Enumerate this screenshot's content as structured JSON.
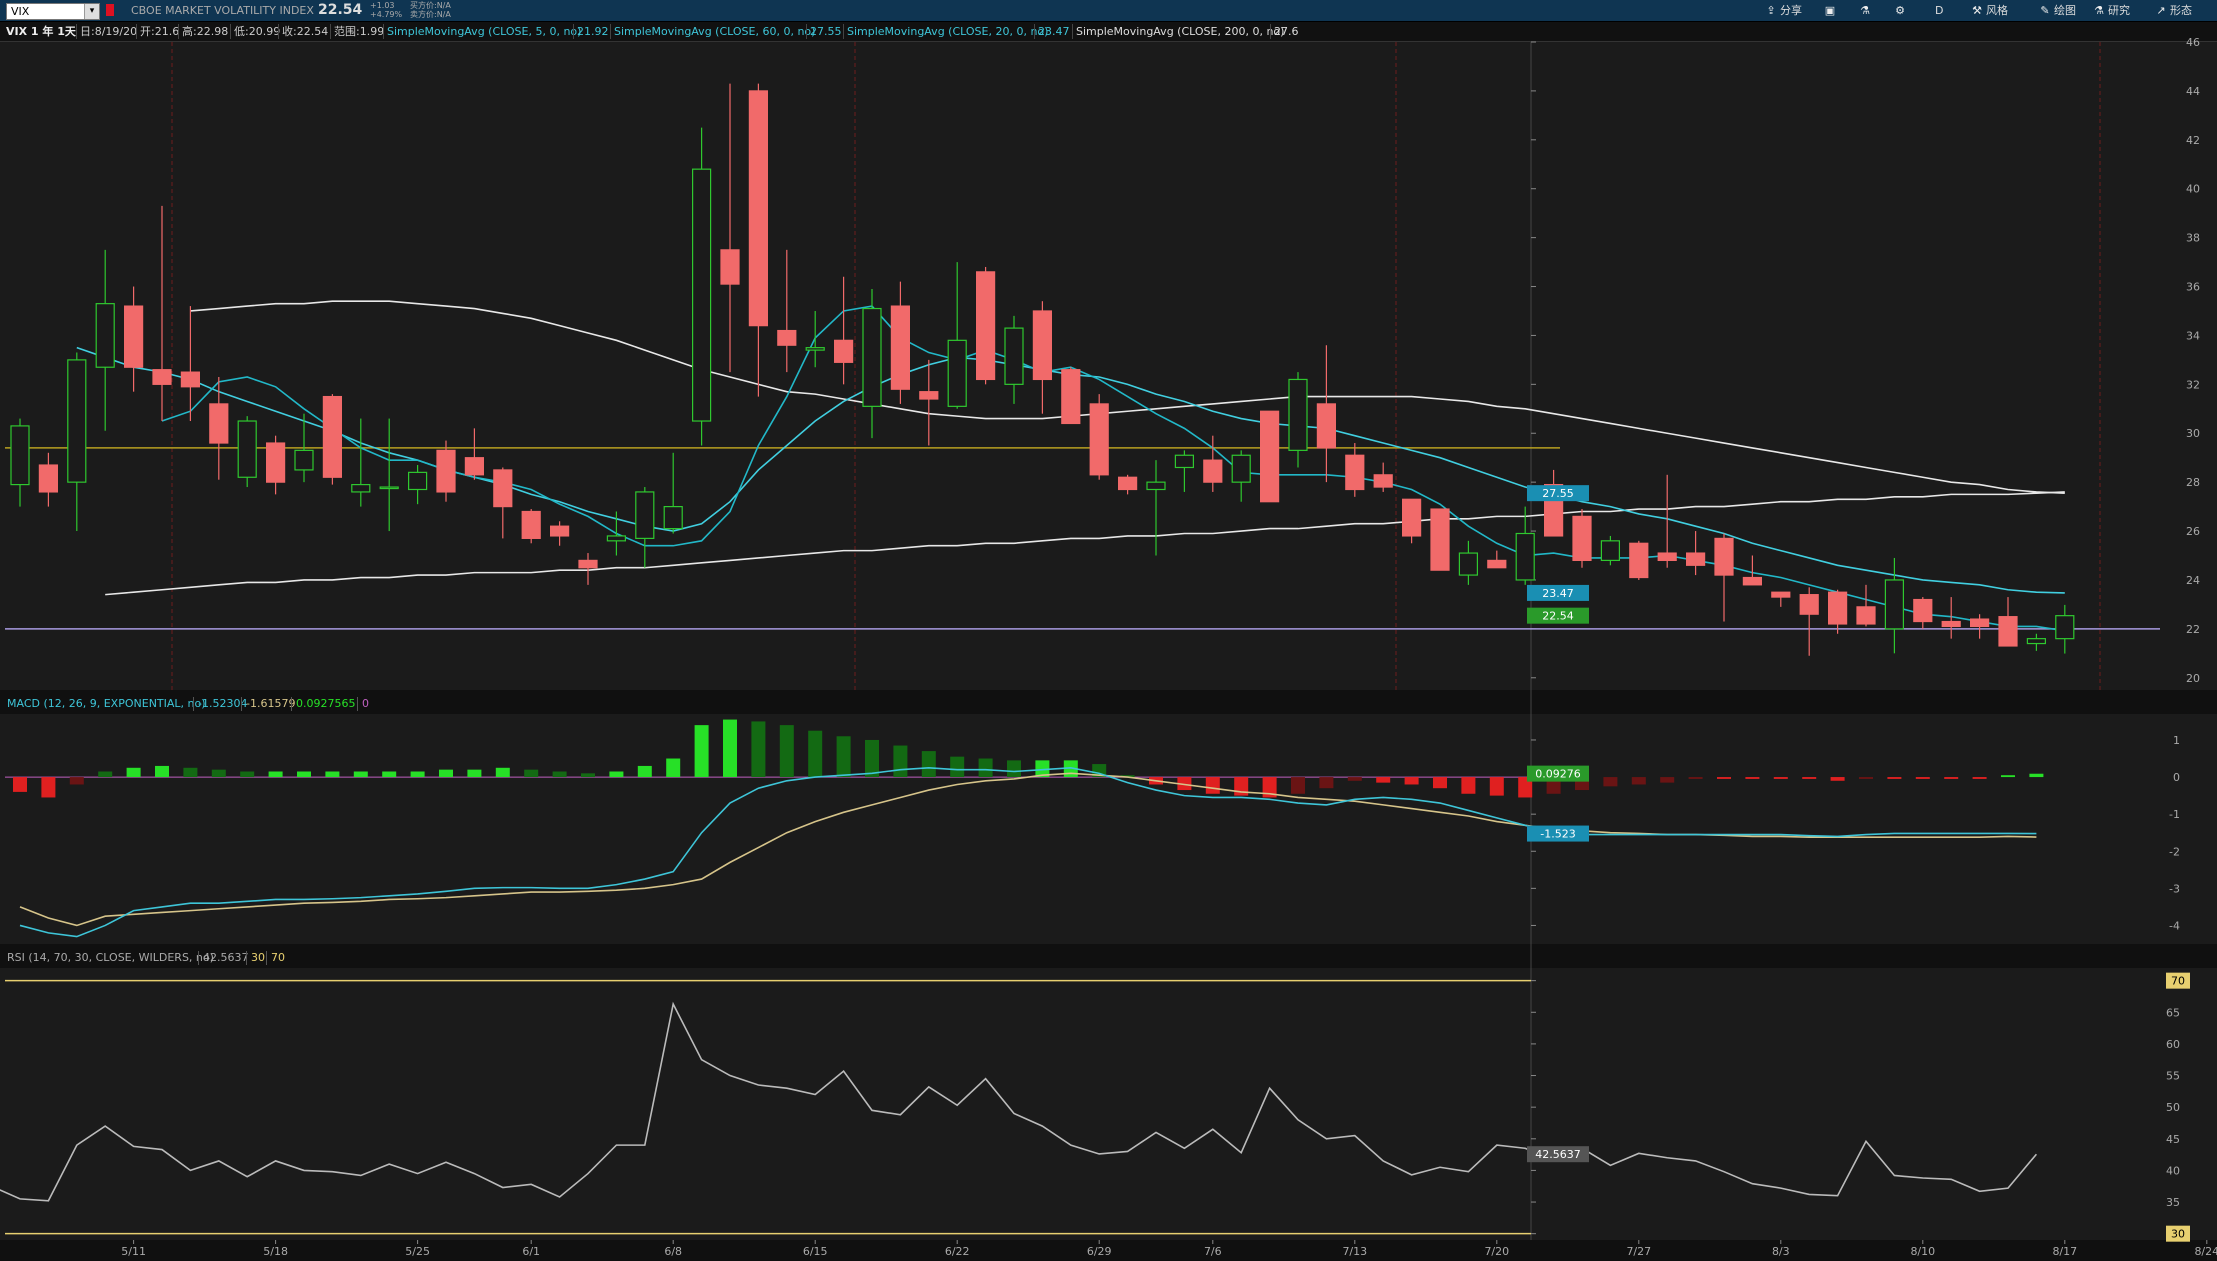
{
  "toolbar": {
    "symbol": "VIX",
    "company": "CBOE MARKET VOLATILITY INDEX",
    "last": "22.54",
    "change": "+1.03",
    "change_pct": "+4.79%",
    "bid": "买方价:N/A",
    "ask": "卖方价:N/A",
    "share": "分享",
    "style": "风格",
    "drawing": "绘图",
    "studies": "研究",
    "patterns": "形态",
    "aggregation": "D"
  },
  "infobar": {
    "period": "VIX 1 年 1天",
    "date": "日:8/19/20",
    "open": "开:21.6",
    "high": "高:22.98",
    "low": "低:20.99",
    "close": "收:22.54",
    "range": "范围:1.99",
    "sma5_label": "SimpleMovingAvg (CLOSE, 5, 0, no)",
    "sma5_val": "21.92",
    "sma60_label": "SimpleMovingAvg (CLOSE, 60, 0, no)",
    "sma60_val": "27.55",
    "sma20_label": "SimpleMovingAvg (CLOSE, 20, 0, no)",
    "sma20_val": "23.47",
    "sma200_label": "SimpleMovingAvg (CLOSE, 200, 0, no)",
    "sma200_val": "27.6"
  },
  "macd_header": {
    "label": "MACD (12, 26, 9, EXPONENTIAL, no)",
    "v1": "-1.52304",
    "v2": "-1.61579",
    "v3": "0.0927565",
    "v4": "0"
  },
  "rsi_header": {
    "label": "RSI (14, 70, 30, CLOSE, WILDERS, no)",
    "v1": "42.5637",
    "v2": "30",
    "v3": "70"
  },
  "colors": {
    "up": "#2fc82f",
    "down": "#f16a6a",
    "sma5": "#22b8c8",
    "sma20": "#41cfe0",
    "sma60": "#e8e8e8",
    "sma200": "#e8e8e8",
    "hline_yellow": "#b8a020",
    "hline_lav": "#a89be0",
    "grid_v": "#6e1c1c",
    "macd_line": "#3ec5d8",
    "signal_line": "#d6c48a",
    "hist_pos": "#27e027",
    "hist_pos_fade": "#136a13",
    "hist_neg": "#e02020",
    "hist_neg_fade": "#6a1414",
    "rsi_line": "#bbbbbb"
  },
  "chart_data": {
    "type": "candlestick",
    "title": "VIX 1 年 1天",
    "x_tick_labels": [
      "5/11",
      "5/18",
      "5/25",
      "6/1",
      "6/8",
      "6/15",
      "6/22",
      "6/29",
      "7/6",
      "7/13",
      "7/20",
      "7/27",
      "8/3",
      "8/10",
      "8/17",
      "8/24"
    ],
    "price_axis": {
      "ticks": [
        20,
        22,
        24,
        26,
        28,
        30,
        32,
        34,
        36,
        38,
        40,
        42,
        44,
        46
      ],
      "range": [
        19.5,
        46
      ]
    },
    "candles": [
      {
        "date": "5/5",
        "o": 27.9,
        "h": 30.6,
        "l": 27.0,
        "c": 30.3
      },
      {
        "date": "5/6",
        "o": 28.7,
        "h": 29.2,
        "l": 27.0,
        "c": 27.6
      },
      {
        "date": "5/7",
        "o": 28.0,
        "h": 33.3,
        "l": 26.0,
        "c": 33.0
      },
      {
        "date": "5/8",
        "o": 32.7,
        "h": 37.5,
        "l": 30.1,
        "c": 35.3
      },
      {
        "date": "5/11",
        "o": 35.2,
        "h": 36.0,
        "l": 31.7,
        "c": 32.7
      },
      {
        "date": "5/12",
        "o": 32.6,
        "h": 39.3,
        "l": 30.5,
        "c": 32.0
      },
      {
        "date": "5/13",
        "o": 32.5,
        "h": 35.2,
        "l": 30.5,
        "c": 31.9
      },
      {
        "date": "5/14",
        "o": 31.2,
        "h": 32.3,
        "l": 28.1,
        "c": 29.6
      },
      {
        "date": "5/15",
        "o": 28.2,
        "h": 30.7,
        "l": 27.8,
        "c": 30.5
      },
      {
        "date": "5/18",
        "o": 29.6,
        "h": 29.9,
        "l": 27.5,
        "c": 28.0
      },
      {
        "date": "5/19",
        "o": 28.5,
        "h": 30.8,
        "l": 28.0,
        "c": 29.3
      },
      {
        "date": "5/20",
        "o": 31.5,
        "h": 31.6,
        "l": 27.9,
        "c": 28.2
      },
      {
        "date": "5/21",
        "o": 27.6,
        "h": 30.6,
        "l": 27.0,
        "c": 27.9
      },
      {
        "date": "5/22",
        "o": 27.8,
        "h": 30.6,
        "l": 26.0,
        "c": 27.8
      },
      {
        "date": "5/26",
        "o": 27.7,
        "h": 28.7,
        "l": 27.1,
        "c": 28.4
      },
      {
        "date": "5/27",
        "o": 29.3,
        "h": 29.7,
        "l": 27.2,
        "c": 27.6
      },
      {
        "date": "5/28",
        "o": 29.0,
        "h": 30.2,
        "l": 28.1,
        "c": 28.3
      },
      {
        "date": "5/29",
        "o": 28.5,
        "h": 28.6,
        "l": 25.7,
        "c": 27.0
      },
      {
        "date": "6/1",
        "o": 26.8,
        "h": 26.9,
        "l": 25.5,
        "c": 25.7
      },
      {
        "date": "6/2",
        "o": 26.2,
        "h": 26.4,
        "l": 25.4,
        "c": 25.8
      },
      {
        "date": "6/3",
        "o": 24.8,
        "h": 25.1,
        "l": 23.8,
        "c": 24.5
      },
      {
        "date": "6/4",
        "o": 25.6,
        "h": 26.8,
        "l": 25.0,
        "c": 25.8
      },
      {
        "date": "6/5",
        "o": 25.7,
        "h": 27.8,
        "l": 24.5,
        "c": 27.6
      },
      {
        "date": "6/8",
        "o": 26.1,
        "h": 29.2,
        "l": 25.9,
        "c": 27.0
      },
      {
        "date": "6/9",
        "o": 30.5,
        "h": 42.5,
        "l": 29.5,
        "c": 40.8
      },
      {
        "date": "6/10",
        "o": 37.5,
        "h": 44.3,
        "l": 32.5,
        "c": 36.1
      },
      {
        "date": "6/11",
        "o": 44.0,
        "h": 44.3,
        "l": 31.5,
        "c": 34.4
      },
      {
        "date": "6/12",
        "o": 34.2,
        "h": 37.5,
        "l": 32.5,
        "c": 33.6
      },
      {
        "date": "6/15",
        "o": 33.4,
        "h": 35.0,
        "l": 32.7,
        "c": 33.5
      },
      {
        "date": "6/16",
        "o": 33.8,
        "h": 36.4,
        "l": 32.0,
        "c": 32.9
      },
      {
        "date": "6/17",
        "o": 31.1,
        "h": 35.9,
        "l": 29.8,
        "c": 35.1
      },
      {
        "date": "6/18",
        "o": 35.2,
        "h": 36.2,
        "l": 31.2,
        "c": 31.8
      },
      {
        "date": "6/19",
        "o": 31.7,
        "h": 33.0,
        "l": 29.5,
        "c": 31.4
      },
      {
        "date": "6/22",
        "o": 31.1,
        "h": 37.0,
        "l": 31.0,
        "c": 33.8
      },
      {
        "date": "6/23",
        "o": 36.6,
        "h": 36.8,
        "l": 32.0,
        "c": 32.2
      },
      {
        "date": "6/24",
        "o": 32.0,
        "h": 34.8,
        "l": 31.2,
        "c": 34.3
      },
      {
        "date": "6/25",
        "o": 35.0,
        "h": 35.4,
        "l": 30.8,
        "c": 32.2
      },
      {
        "date": "6/26",
        "o": 32.6,
        "h": 32.7,
        "l": 30.6,
        "c": 30.4
      },
      {
        "date": "6/29",
        "o": 31.2,
        "h": 31.6,
        "l": 28.1,
        "c": 28.3
      },
      {
        "date": "6/30",
        "o": 28.2,
        "h": 28.3,
        "l": 27.5,
        "c": 27.7
      },
      {
        "date": "7/1",
        "o": 27.7,
        "h": 28.9,
        "l": 25.0,
        "c": 28.0
      },
      {
        "date": "7/2",
        "o": 28.6,
        "h": 29.3,
        "l": 27.6,
        "c": 29.1
      },
      {
        "date": "7/6",
        "o": 28.9,
        "h": 29.9,
        "l": 27.6,
        "c": 28.0
      },
      {
        "date": "7/7",
        "o": 28.0,
        "h": 29.3,
        "l": 27.2,
        "c": 29.1
      },
      {
        "date": "7/8",
        "o": 30.9,
        "h": 30.9,
        "l": 28.5,
        "c": 27.2
      },
      {
        "date": "7/9",
        "o": 29.3,
        "h": 32.5,
        "l": 28.6,
        "c": 32.2
      },
      {
        "date": "7/10",
        "o": 31.2,
        "h": 33.6,
        "l": 28.0,
        "c": 29.4
      },
      {
        "date": "7/13",
        "o": 29.1,
        "h": 29.6,
        "l": 27.4,
        "c": 27.7
      },
      {
        "date": "7/14",
        "o": 28.3,
        "h": 28.8,
        "l": 27.6,
        "c": 27.8
      },
      {
        "date": "7/15",
        "o": 27.3,
        "h": 27.3,
        "l": 25.5,
        "c": 25.8
      },
      {
        "date": "7/16",
        "o": 26.9,
        "h": 26.9,
        "l": 24.4,
        "c": 24.4
      },
      {
        "date": "7/17",
        "o": 24.2,
        "h": 25.6,
        "l": 23.8,
        "c": 25.1
      },
      {
        "date": "7/20",
        "o": 24.8,
        "h": 25.2,
        "l": 24.5,
        "c": 24.5
      },
      {
        "date": "7/21",
        "o": 24.0,
        "h": 27.0,
        "l": 23.8,
        "c": 25.9
      },
      {
        "date": "7/22",
        "o": 27.9,
        "h": 28.5,
        "l": 25.8,
        "c": 25.8
      },
      {
        "date": "7/23",
        "o": 26.6,
        "h": 26.9,
        "l": 24.5,
        "c": 24.8
      },
      {
        "date": "7/24",
        "o": 24.8,
        "h": 25.8,
        "l": 24.6,
        "c": 25.6
      },
      {
        "date": "7/27",
        "o": 25.5,
        "h": 25.6,
        "l": 24.0,
        "c": 24.1
      },
      {
        "date": "7/28",
        "o": 25.1,
        "h": 28.3,
        "l": 24.5,
        "c": 24.8
      },
      {
        "date": "7/29",
        "o": 25.1,
        "h": 26.0,
        "l": 24.2,
        "c": 24.6
      },
      {
        "date": "7/30",
        "o": 25.7,
        "h": 25.9,
        "l": 22.3,
        "c": 24.2
      },
      {
        "date": "7/31",
        "o": 24.1,
        "h": 25.0,
        "l": 23.8,
        "c": 23.8
      },
      {
        "date": "8/3",
        "o": 23.5,
        "h": 23.5,
        "l": 22.9,
        "c": 23.3
      },
      {
        "date": "8/4",
        "o": 23.4,
        "h": 23.7,
        "l": 20.9,
        "c": 22.6
      },
      {
        "date": "8/5",
        "o": 23.5,
        "h": 23.6,
        "l": 21.8,
        "c": 22.2
      },
      {
        "date": "8/6",
        "o": 22.9,
        "h": 23.8,
        "l": 22.1,
        "c": 22.2
      },
      {
        "date": "8/7",
        "o": 22.0,
        "h": 24.9,
        "l": 21.0,
        "c": 24.0
      },
      {
        "date": "8/10",
        "o": 23.2,
        "h": 23.3,
        "l": 22.0,
        "c": 22.3
      },
      {
        "date": "8/11",
        "o": 22.3,
        "h": 23.3,
        "l": 21.6,
        "c": 22.1
      },
      {
        "date": "8/12",
        "o": 22.4,
        "h": 22.6,
        "l": 21.6,
        "c": 22.1
      },
      {
        "date": "8/13",
        "o": 22.5,
        "h": 23.3,
        "l": 21.9,
        "c": 21.3
      },
      {
        "date": "8/14",
        "o": 21.4,
        "h": 21.8,
        "l": 21.1,
        "c": 21.6
      },
      {
        "date": "8/17",
        "o": 21.6,
        "h": 22.98,
        "l": 20.99,
        "c": 22.54
      }
    ],
    "sma5_values": [
      null,
      null,
      null,
      null,
      30.5,
      30.9,
      32.1,
      32.3,
      31.9,
      31.0,
      30.2,
      29.4,
      28.9,
      28.9,
      28.5,
      28.2,
      28.0,
      27.7,
      27.1,
      26.6,
      25.9,
      25.4,
      25.4,
      25.6,
      26.8,
      29.5,
      31.5,
      33.9,
      35.0,
      35.2,
      33.9,
      33.3,
      33.0,
      33.4,
      33.0,
      32.5,
      32.7,
      32.2,
      31.5,
      30.8,
      30.2,
      29.4,
      28.4,
      28.3,
      28.3,
      28.3,
      28.2,
      28.0,
      27.7,
      27.1,
      26.2,
      25.5,
      25.0,
      25.1,
      24.9,
      24.9,
      24.9,
      25.0,
      24.8,
      24.6,
      24.3,
      24.1,
      23.8,
      23.5,
      23.2,
      22.9,
      22.6,
      22.5,
      22.3,
      22.1,
      22.1,
      21.92
    ],
    "sma20_values": [
      33.5,
      33.1,
      32.7,
      32.5,
      32.2,
      31.7,
      31.3,
      30.9,
      30.5,
      30.1,
      29.6,
      29.2,
      28.9,
      28.5,
      28.2,
      27.9,
      27.5,
      27.2,
      26.8,
      26.5,
      26.2,
      26.0,
      26.3,
      27.2,
      28.5,
      29.5,
      30.5,
      31.3,
      31.9,
      32.4,
      32.8,
      33.1,
      33.0,
      32.8,
      32.6,
      32.4,
      32.3,
      32.0,
      31.6,
      31.3,
      30.9,
      30.6,
      30.4,
      30.3,
      30.2,
      29.9,
      29.6,
      29.3,
      29.0,
      28.6,
      28.2,
      27.8,
      27.5,
      27.2,
      27.0,
      26.7,
      26.5,
      26.2,
      25.9,
      25.5,
      25.2,
      24.9,
      24.6,
      24.4,
      24.2,
      24.0,
      23.9,
      23.8,
      23.6,
      23.5,
      23.47
    ],
    "sma60_values": [
      35.0,
      35.1,
      35.2,
      35.3,
      35.3,
      35.4,
      35.4,
      35.4,
      35.3,
      35.2,
      35.1,
      34.9,
      34.7,
      34.4,
      34.1,
      33.8,
      33.4,
      33.0,
      32.6,
      32.3,
      32.0,
      31.7,
      31.6,
      31.4,
      31.2,
      31.0,
      30.8,
      30.7,
      30.6,
      30.6,
      30.6,
      30.7,
      30.8,
      30.9,
      31.0,
      31.1,
      31.2,
      31.3,
      31.4,
      31.5,
      31.5,
      31.5,
      31.5,
      31.5,
      31.4,
      31.3,
      31.1,
      31.0,
      30.8,
      30.6,
      30.4,
      30.2,
      30.0,
      29.8,
      29.6,
      29.4,
      29.2,
      29.0,
      28.8,
      28.6,
      28.4,
      28.2,
      28.0,
      27.9,
      27.7,
      27.6,
      27.55
    ],
    "sma200_values": [
      23.4,
      23.5,
      23.6,
      23.7,
      23.8,
      23.9,
      23.9,
      24.0,
      24.0,
      24.1,
      24.1,
      24.2,
      24.2,
      24.3,
      24.3,
      24.3,
      24.4,
      24.4,
      24.5,
      24.5,
      24.6,
      24.7,
      24.8,
      24.9,
      25.0,
      25.1,
      25.2,
      25.2,
      25.3,
      25.4,
      25.4,
      25.5,
      25.5,
      25.6,
      25.7,
      25.7,
      25.8,
      25.8,
      25.9,
      25.9,
      26.0,
      26.1,
      26.1,
      26.2,
      26.3,
      26.3,
      26.4,
      26.5,
      26.5,
      26.6,
      26.6,
      26.7,
      26.8,
      26.8,
      26.9,
      26.9,
      27.0,
      27.0,
      27.1,
      27.2,
      27.2,
      27.3,
      27.3,
      27.4,
      27.4,
      27.5,
      27.5,
      27.5,
      27.55,
      27.6
    ],
    "hlines": [
      29.4,
      22.0
    ],
    "price_labels": [
      {
        "text": "27.55",
        "value": 27.55,
        "bg": "#1a8fb3"
      },
      {
        "text": "23.47",
        "value": 23.47,
        "bg": "#1a8fb3"
      },
      {
        "text": "22.54",
        "value": 22.54,
        "bg": "#2a9a2a"
      }
    ],
    "macd": {
      "ticks": [
        1,
        0,
        -1,
        -2,
        -3,
        -4
      ],
      "range": [
        -4.5,
        1.7
      ],
      "histogram": [
        -0.4,
        -0.55,
        -0.2,
        0.15,
        0.25,
        0.3,
        0.25,
        0.2,
        0.15,
        0.15,
        0.15,
        0.15,
        0.15,
        0.15,
        0.15,
        0.2,
        0.2,
        0.25,
        0.2,
        0.15,
        0.1,
        0.15,
        0.3,
        0.5,
        1.4,
        1.55,
        1.5,
        1.4,
        1.25,
        1.1,
        1.0,
        0.85,
        0.7,
        0.55,
        0.5,
        0.45,
        0.45,
        0.45,
        0.35,
        0.05,
        -0.2,
        -0.35,
        -0.45,
        -0.5,
        -0.55,
        -0.45,
        -0.3,
        -0.1,
        -0.15,
        -0.2,
        -0.3,
        -0.45,
        -0.5,
        -0.55,
        -0.45,
        -0.35,
        -0.25,
        -0.2,
        -0.15,
        -0.05,
        -0.05,
        -0.05,
        -0.05,
        -0.05,
        -0.1,
        -0.05,
        -0.05,
        -0.05,
        -0.05,
        -0.05,
        0.05,
        0.09
      ],
      "macd_line": [
        -4.0,
        -4.2,
        -4.3,
        -4.0,
        -3.6,
        -3.5,
        -3.4,
        -3.4,
        -3.35,
        -3.3,
        -3.3,
        -3.28,
        -3.25,
        -3.2,
        -3.15,
        -3.08,
        -3.0,
        -2.98,
        -2.98,
        -3.0,
        -3.0,
        -2.9,
        -2.75,
        -2.55,
        -1.5,
        -0.7,
        -0.3,
        -0.1,
        0.0,
        0.05,
        0.1,
        0.2,
        0.25,
        0.2,
        0.2,
        0.15,
        0.2,
        0.25,
        0.1,
        -0.15,
        -0.35,
        -0.5,
        -0.55,
        -0.55,
        -0.6,
        -0.7,
        -0.75,
        -0.6,
        -0.55,
        -0.6,
        -0.7,
        -0.9,
        -1.1,
        -1.3,
        -1.55,
        -1.55,
        -1.55,
        -1.55,
        -1.55,
        -1.55,
        -1.55,
        -1.55,
        -1.55,
        -1.58,
        -1.6,
        -1.55,
        -1.52,
        -1.52,
        -1.52,
        -1.52,
        -1.52,
        -1.523
      ],
      "signal_line": [
        -3.5,
        -3.8,
        -4.0,
        -3.75,
        -3.7,
        -3.65,
        -3.6,
        -3.55,
        -3.5,
        -3.45,
        -3.4,
        -3.38,
        -3.35,
        -3.3,
        -3.28,
        -3.25,
        -3.2,
        -3.15,
        -3.1,
        -3.1,
        -3.08,
        -3.05,
        -3.0,
        -2.9,
        -2.75,
        -2.3,
        -1.9,
        -1.5,
        -1.2,
        -0.95,
        -0.75,
        -0.55,
        -0.35,
        -0.2,
        -0.1,
        -0.05,
        0.05,
        0.1,
        0.05,
        0.0,
        -0.1,
        -0.2,
        -0.3,
        -0.4,
        -0.45,
        -0.55,
        -0.6,
        -0.65,
        -0.75,
        -0.85,
        -0.95,
        -1.05,
        -1.2,
        -1.3,
        -1.4,
        -1.45,
        -1.5,
        -1.52,
        -1.55,
        -1.55,
        -1.57,
        -1.6,
        -1.6,
        -1.62,
        -1.62,
        -1.62,
        -1.62,
        -1.62,
        -1.62,
        -1.62,
        -1.6,
        -1.616
      ],
      "zero_label": {
        "text": "0.09276",
        "bg": "#2a9a2a"
      },
      "line_label": {
        "text": "-1.523",
        "bg": "#1a8fb3"
      }
    },
    "rsi": {
      "ticks": [
        70,
        65,
        60,
        55,
        50,
        45,
        40,
        35,
        30
      ],
      "range": [
        29,
        72
      ],
      "values": [
        37.5,
        35.5,
        35.2,
        44.0,
        47.0,
        43.8,
        43.3,
        40.0,
        41.5,
        39.0,
        41.5,
        40.0,
        39.8,
        39.2,
        41.0,
        39.5,
        41.3,
        39.5,
        37.3,
        37.8,
        35.8,
        39.5,
        44.0,
        44.0,
        66.3,
        57.5,
        55.0,
        53.5,
        53.0,
        52.0,
        55.7,
        49.5,
        48.8,
        53.2,
        50.3,
        54.5,
        49.0,
        47.0,
        44.0,
        42.6,
        43.0,
        46.0,
        43.5,
        46.5,
        42.8,
        53.0,
        48.0,
        45.0,
        45.5,
        41.5,
        39.3,
        40.5,
        39.8,
        44.0,
        43.5,
        41.5,
        43.5,
        40.8,
        42.7,
        42.0,
        41.5,
        39.8,
        37.9,
        37.2,
        36.2,
        36.0,
        44.6,
        39.2,
        38.8,
        38.6,
        36.7,
        37.2,
        42.5637
      ],
      "levels": [
        30,
        70
      ],
      "value_label": {
        "text": "42.5637",
        "bg": "#555"
      }
    }
  }
}
